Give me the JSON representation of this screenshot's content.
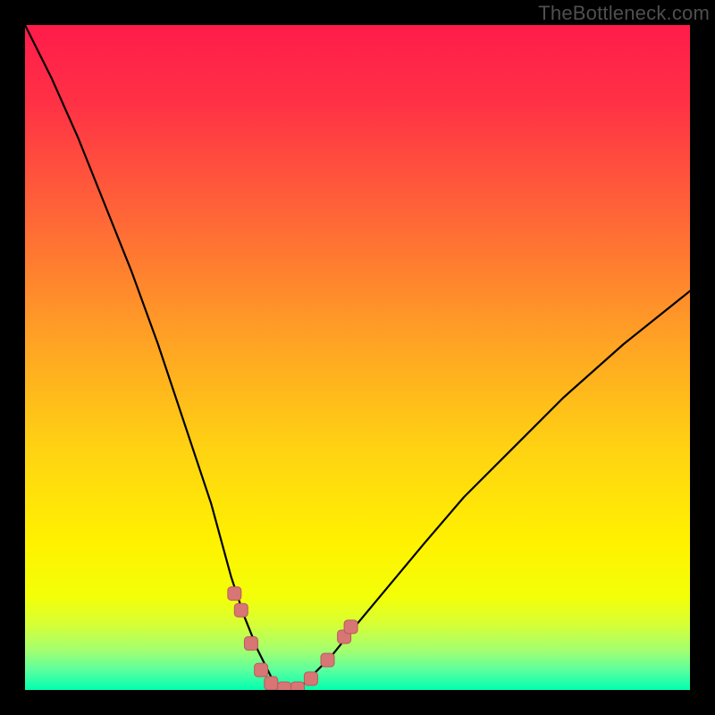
{
  "watermark": "TheBottleneck.com",
  "colors": {
    "bg_black": "#000000",
    "gradient_stops": [
      {
        "offset": 0.0,
        "color": "#ff1b4b"
      },
      {
        "offset": 0.12,
        "color": "#ff3245"
      },
      {
        "offset": 0.3,
        "color": "#ff6a36"
      },
      {
        "offset": 0.48,
        "color": "#ffa424"
      },
      {
        "offset": 0.64,
        "color": "#ffd312"
      },
      {
        "offset": 0.78,
        "color": "#fff200"
      },
      {
        "offset": 0.86,
        "color": "#f3ff08"
      },
      {
        "offset": 0.9,
        "color": "#d8ff34"
      },
      {
        "offset": 0.94,
        "color": "#a4ff70"
      },
      {
        "offset": 0.97,
        "color": "#5cff9e"
      },
      {
        "offset": 1.0,
        "color": "#00ffb0"
      }
    ],
    "curve": "#000000",
    "marker_fill": "#d77675",
    "marker_stroke": "#b95b5a"
  },
  "chart_data": {
    "type": "line",
    "title": "",
    "xlabel": "",
    "ylabel": "",
    "xlim": [
      0,
      100
    ],
    "ylim": [
      0,
      100
    ],
    "grid": false,
    "legend": false,
    "series": [
      {
        "name": "bottleneck-curve",
        "x": [
          0,
          4,
          8,
          12,
          16,
          20,
          24,
          28,
          31,
          33,
          35,
          37,
          39,
          41,
          43,
          46,
          50,
          55,
          60,
          66,
          73,
          81,
          90,
          100
        ],
        "y": [
          100,
          92,
          83,
          73,
          63,
          52,
          40,
          28,
          17,
          11,
          6,
          2,
          0,
          0,
          2,
          5,
          10,
          16,
          22,
          29,
          36,
          44,
          52,
          60
        ]
      }
    ],
    "markers": [
      {
        "x": 31.5,
        "y": 14.5
      },
      {
        "x": 32.5,
        "y": 12.0
      },
      {
        "x": 34.0,
        "y": 7.0
      },
      {
        "x": 35.5,
        "y": 3.0
      },
      {
        "x": 37.0,
        "y": 1.0
      },
      {
        "x": 39.0,
        "y": 0.2
      },
      {
        "x": 41.0,
        "y": 0.2
      },
      {
        "x": 43.0,
        "y": 1.7
      },
      {
        "x": 45.5,
        "y": 4.5
      },
      {
        "x": 48.0,
        "y": 8.0
      },
      {
        "x": 49.0,
        "y": 9.5
      }
    ]
  }
}
